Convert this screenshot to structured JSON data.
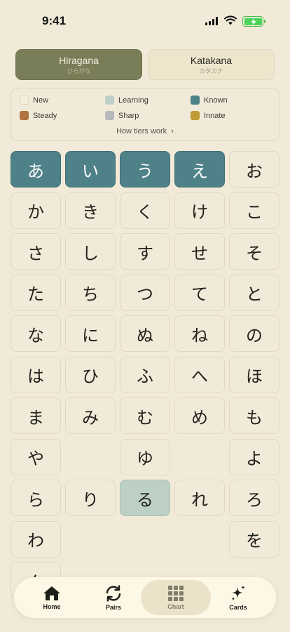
{
  "status": {
    "time": "9:41"
  },
  "segmented": [
    {
      "label": "Hiragana",
      "sub": "ひらがな",
      "active": true
    },
    {
      "label": "Katakana",
      "sub": "カタカナ",
      "active": false
    }
  ],
  "legend": {
    "items": [
      {
        "label": "New",
        "color": "#f3ecdc"
      },
      {
        "label": "Learning",
        "color": "#bcd0c6"
      },
      {
        "label": "Known",
        "color": "#4f8189"
      },
      {
        "label": "Steady",
        "color": "#b0743e"
      },
      {
        "label": "Sharp",
        "color": "#b7b8bc"
      },
      {
        "label": "Innate",
        "color": "#c09a35"
      }
    ],
    "link": "How tiers work",
    "link_chevron": "›"
  },
  "grid": [
    [
      {
        "kana": "あ",
        "tier": "known"
      },
      {
        "kana": "い",
        "tier": "known"
      },
      {
        "kana": "う",
        "tier": "known"
      },
      {
        "kana": "え",
        "tier": "known"
      },
      {
        "kana": "お",
        "tier": "new"
      }
    ],
    [
      {
        "kana": "か",
        "tier": "new"
      },
      {
        "kana": "き",
        "tier": "new"
      },
      {
        "kana": "く",
        "tier": "new"
      },
      {
        "kana": "け",
        "tier": "new"
      },
      {
        "kana": "こ",
        "tier": "new"
      }
    ],
    [
      {
        "kana": "さ",
        "tier": "new"
      },
      {
        "kana": "し",
        "tier": "new"
      },
      {
        "kana": "す",
        "tier": "new"
      },
      {
        "kana": "せ",
        "tier": "new"
      },
      {
        "kana": "そ",
        "tier": "new"
      }
    ],
    [
      {
        "kana": "た",
        "tier": "new"
      },
      {
        "kana": "ち",
        "tier": "new"
      },
      {
        "kana": "つ",
        "tier": "new"
      },
      {
        "kana": "て",
        "tier": "new"
      },
      {
        "kana": "と",
        "tier": "new"
      }
    ],
    [
      {
        "kana": "な",
        "tier": "new"
      },
      {
        "kana": "に",
        "tier": "new"
      },
      {
        "kana": "ぬ",
        "tier": "new"
      },
      {
        "kana": "ね",
        "tier": "new"
      },
      {
        "kana": "の",
        "tier": "new"
      }
    ],
    [
      {
        "kana": "は",
        "tier": "new"
      },
      {
        "kana": "ひ",
        "tier": "new"
      },
      {
        "kana": "ふ",
        "tier": "new"
      },
      {
        "kana": "へ",
        "tier": "new"
      },
      {
        "kana": "ほ",
        "tier": "new"
      }
    ],
    [
      {
        "kana": "ま",
        "tier": "new"
      },
      {
        "kana": "み",
        "tier": "new"
      },
      {
        "kana": "む",
        "tier": "new"
      },
      {
        "kana": "め",
        "tier": "new"
      },
      {
        "kana": "も",
        "tier": "new"
      }
    ],
    [
      {
        "kana": "や",
        "tier": "new"
      },
      null,
      {
        "kana": "ゆ",
        "tier": "new"
      },
      null,
      {
        "kana": "よ",
        "tier": "new"
      }
    ],
    [
      {
        "kana": "ら",
        "tier": "new"
      },
      {
        "kana": "り",
        "tier": "new"
      },
      {
        "kana": "る",
        "tier": "learning"
      },
      {
        "kana": "れ",
        "tier": "new"
      },
      {
        "kana": "ろ",
        "tier": "new"
      }
    ],
    [
      {
        "kana": "わ",
        "tier": "new"
      },
      null,
      null,
      null,
      {
        "kana": "を",
        "tier": "new"
      }
    ],
    [
      {
        "kana": "ん",
        "tier": "new"
      },
      null,
      null,
      null,
      null
    ]
  ],
  "tabs": [
    {
      "label": "Home",
      "icon": "home-icon",
      "active": false
    },
    {
      "label": "Pairs",
      "icon": "refresh-icon",
      "active": false
    },
    {
      "label": "Chart",
      "icon": "grid-icon",
      "active": true
    },
    {
      "label": "Cards",
      "icon": "sparkle-icon",
      "active": false
    }
  ]
}
